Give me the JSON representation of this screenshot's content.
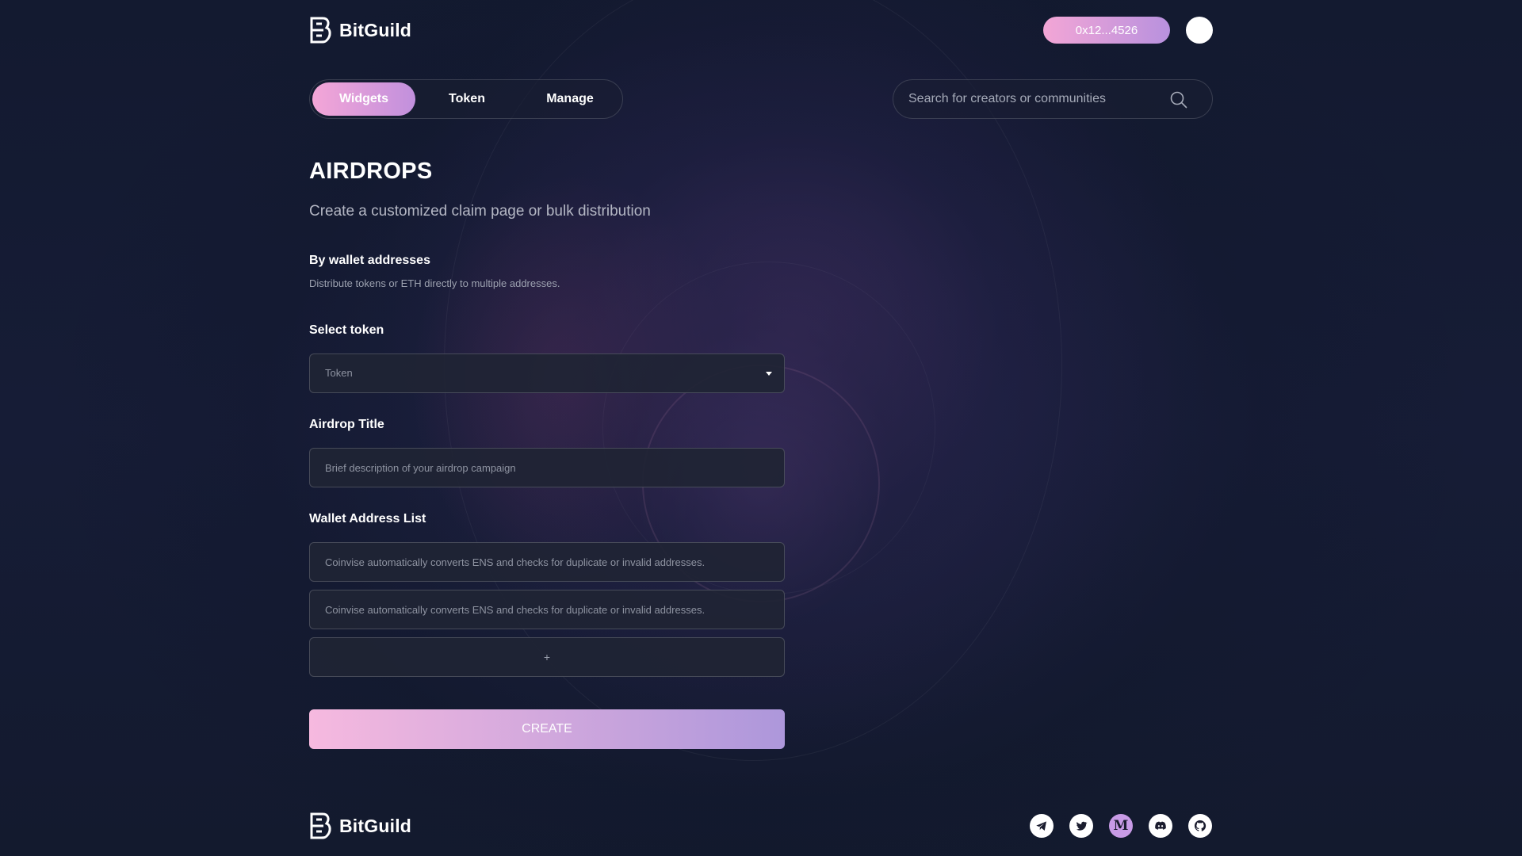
{
  "brand": {
    "name": "BitGuild"
  },
  "header": {
    "wallet_label": "0x12...4526"
  },
  "nav": {
    "tabs": [
      {
        "label": "Widgets"
      },
      {
        "label": "Token"
      },
      {
        "label": "Manage"
      }
    ]
  },
  "search": {
    "placeholder": "Search for creators or communities"
  },
  "page": {
    "title": "AIRDROPS",
    "subtitle": "Create a customized claim page or bulk distribution",
    "section_title": "By wallet addresses",
    "section_desc": "Distribute tokens or ETH directly to multiple addresses."
  },
  "form": {
    "token_label": "Select token",
    "token_value": "Token",
    "title_label": "Airdrop Title",
    "title_placeholder": "Brief description of your airdrop campaign",
    "address_label": "Wallet Address List",
    "address_placeholders": [
      "Coinvise automatically converts ENS and checks for duplicate or invalid addresses.",
      "Coinvise automatically converts ENS and checks for duplicate or invalid addresses."
    ],
    "add_label": "+",
    "create_label": "CREATE"
  },
  "footer": {
    "socials": [
      "telegram-icon",
      "twitter-icon",
      "medium-icon",
      "discord-icon",
      "github-icon"
    ],
    "medium_letter": "M"
  },
  "colors": {
    "accent_start": "#f4a6d7",
    "accent_end": "#b891de",
    "background": "#151b33"
  }
}
